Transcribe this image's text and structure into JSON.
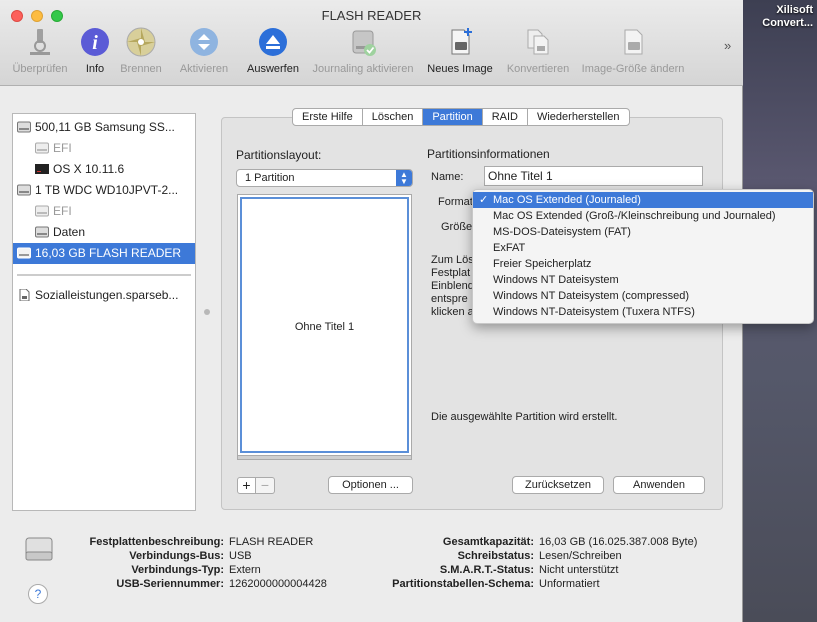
{
  "window": {
    "title": "FLASH READER"
  },
  "desktop": {
    "label_line1": "Xilisoft",
    "label_line2": "Convert..."
  },
  "toolbar": {
    "items": [
      {
        "label": "Überprüfen",
        "enabled": false
      },
      {
        "label": "Info",
        "enabled": true
      },
      {
        "label": "Brennen",
        "enabled": false
      },
      {
        "label": "Aktivieren",
        "enabled": false
      },
      {
        "label": "Auswerfen",
        "enabled": true
      },
      {
        "label": "Journaling aktivieren",
        "enabled": false
      },
      {
        "label": "Neues Image",
        "enabled": true
      },
      {
        "label": "Konvertieren",
        "enabled": false
      },
      {
        "label": "Image-Größe ändern",
        "enabled": false
      }
    ],
    "more": "»"
  },
  "sidebar": {
    "items": [
      {
        "label": "500,11 GB Samsung SS..."
      },
      {
        "label": "EFI"
      },
      {
        "label": "OS X 10.11.6"
      },
      {
        "label": "1 TB WDC WD10JPVT-2..."
      },
      {
        "label": "EFI"
      },
      {
        "label": "Daten"
      },
      {
        "label": "16,03 GB FLASH READER"
      },
      {
        "label": "Sozialleistungen.sparseb..."
      }
    ]
  },
  "tabs": [
    "Erste Hilfe",
    "Löschen",
    "Partition",
    "RAID",
    "Wiederherstellen"
  ],
  "partition": {
    "layout_label": "Partitionslayout:",
    "layout_value": "1 Partition",
    "partition_name_display": "Ohne Titel 1",
    "info_title": "Partitionsinformationen",
    "name_label": "Name:",
    "name_value": "Ohne Titel 1",
    "format_label": "Format:",
    "size_label": "Größe:",
    "description_lines": [
      "Zum Lös",
      "Festplat",
      "Einblend",
      "entspre",
      "klicken a"
    ],
    "status_text": "Die ausgewählte Partition wird erstellt.",
    "plus": "+",
    "minus": "−",
    "options_button": "Optionen ...",
    "reset_button": "Zurücksetzen",
    "apply_button": "Anwenden"
  },
  "format_menu": {
    "checkmark": "✓",
    "items": [
      "Mac OS Extended (Journaled)",
      "Mac OS Extended (Groß-/Kleinschreibung und Journaled)",
      "MS-DOS-Dateisystem (FAT)",
      "ExFAT",
      "Freier Speicherplatz",
      "Windows NT Dateisystem",
      "Windows NT Dateisystem (compressed)",
      "Windows NT-Dateisystem (Tuxera NTFS)"
    ]
  },
  "info": {
    "left": [
      {
        "label": "Festplattenbeschreibung:",
        "value": "FLASH READER"
      },
      {
        "label": "Verbindungs-Bus:",
        "value": "USB"
      },
      {
        "label": "Verbindungs-Typ:",
        "value": "Extern"
      },
      {
        "label": "USB-Seriennummer:",
        "value": "1262000000004428"
      }
    ],
    "right": [
      {
        "label": "Gesamtkapazität:",
        "value": "16,03 GB (16.025.387.008 Byte)"
      },
      {
        "label": "Schreibstatus:",
        "value": "Lesen/Schreiben"
      },
      {
        "label": "S.M.A.R.T.-Status:",
        "value": "Nicht unterstützt"
      },
      {
        "label": "Partitionstabellen-Schema:",
        "value": "Unformatiert"
      }
    ],
    "help": "?"
  },
  "colors": {
    "accent": "#3d79d8"
  }
}
